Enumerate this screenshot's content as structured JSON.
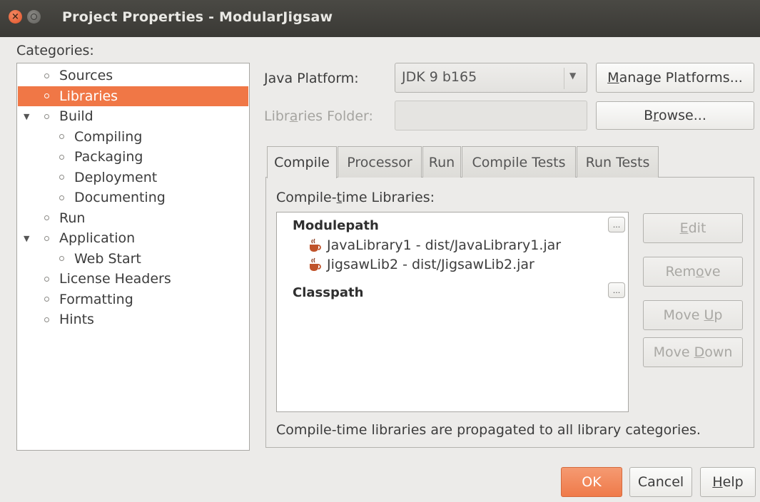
{
  "window": {
    "title": "Project Properties - ModularJigsaw"
  },
  "categories": {
    "label": "Categories:",
    "items": [
      {
        "label": "Sources",
        "selected": false,
        "expanded": null,
        "level": 0
      },
      {
        "label": "Libraries",
        "selected": true,
        "expanded": null,
        "level": 0
      },
      {
        "label": "Build",
        "selected": false,
        "expanded": true,
        "level": 0
      },
      {
        "label": "Compiling",
        "selected": false,
        "expanded": null,
        "level": 1
      },
      {
        "label": "Packaging",
        "selected": false,
        "expanded": null,
        "level": 1
      },
      {
        "label": "Deployment",
        "selected": false,
        "expanded": null,
        "level": 1
      },
      {
        "label": "Documenting",
        "selected": false,
        "expanded": null,
        "level": 1
      },
      {
        "label": "Run",
        "selected": false,
        "expanded": null,
        "level": 0
      },
      {
        "label": "Application",
        "selected": false,
        "expanded": true,
        "level": 0
      },
      {
        "label": "Web Start",
        "selected": false,
        "expanded": null,
        "level": 1
      },
      {
        "label": "License Headers",
        "selected": false,
        "expanded": null,
        "level": 0
      },
      {
        "label": "Formatting",
        "selected": false,
        "expanded": null,
        "level": 0
      },
      {
        "label": "Hints",
        "selected": false,
        "expanded": null,
        "level": 0
      }
    ]
  },
  "platform": {
    "label_prefix": "J",
    "label_rest": "ava Platform:",
    "value": "JDK 9 b165",
    "manage_prefix": "M",
    "manage_rest": "anage Platforms..."
  },
  "libraries_folder": {
    "label_a": "Libr",
    "label_u": "a",
    "label_b": "ries Folder:",
    "value": "",
    "browse_a": "B",
    "browse_u": "r",
    "browse_b": "owse..."
  },
  "tabs": [
    {
      "label": "Compile",
      "active": true
    },
    {
      "label": "Processor",
      "active": false
    },
    {
      "label": "Run",
      "active": false
    },
    {
      "label": "Compile Tests",
      "active": false
    },
    {
      "label": "Run Tests",
      "active": false
    }
  ],
  "compile": {
    "label_a": "Compile-",
    "label_u": "t",
    "label_b": "ime Libraries:",
    "modulepath_heading": "Modulepath",
    "modulepath_items": [
      "JavaLibrary1 - dist/JavaLibrary1.jar",
      "JigsawLib2 - dist/JigsawLib2.jar"
    ],
    "classpath_heading": "Classpath",
    "more_label": "...",
    "footnote": "Compile-time libraries are propagated to all library categories."
  },
  "side_buttons": {
    "edit_u": "E",
    "edit_rest": "dit",
    "remove_a": "Rem",
    "remove_u": "o",
    "remove_b": "ve",
    "moveup_a": "Move ",
    "moveup_u": "U",
    "moveup_b": "p",
    "movedown_a": "Move ",
    "movedown_u": "D",
    "movedown_b": "own"
  },
  "dialog_buttons": {
    "ok": "OK",
    "cancel": "Cancel",
    "help_u": "H",
    "help_rest": "elp"
  },
  "colors": {
    "accent": "#f07746",
    "titlebar": "#3c3b37"
  }
}
